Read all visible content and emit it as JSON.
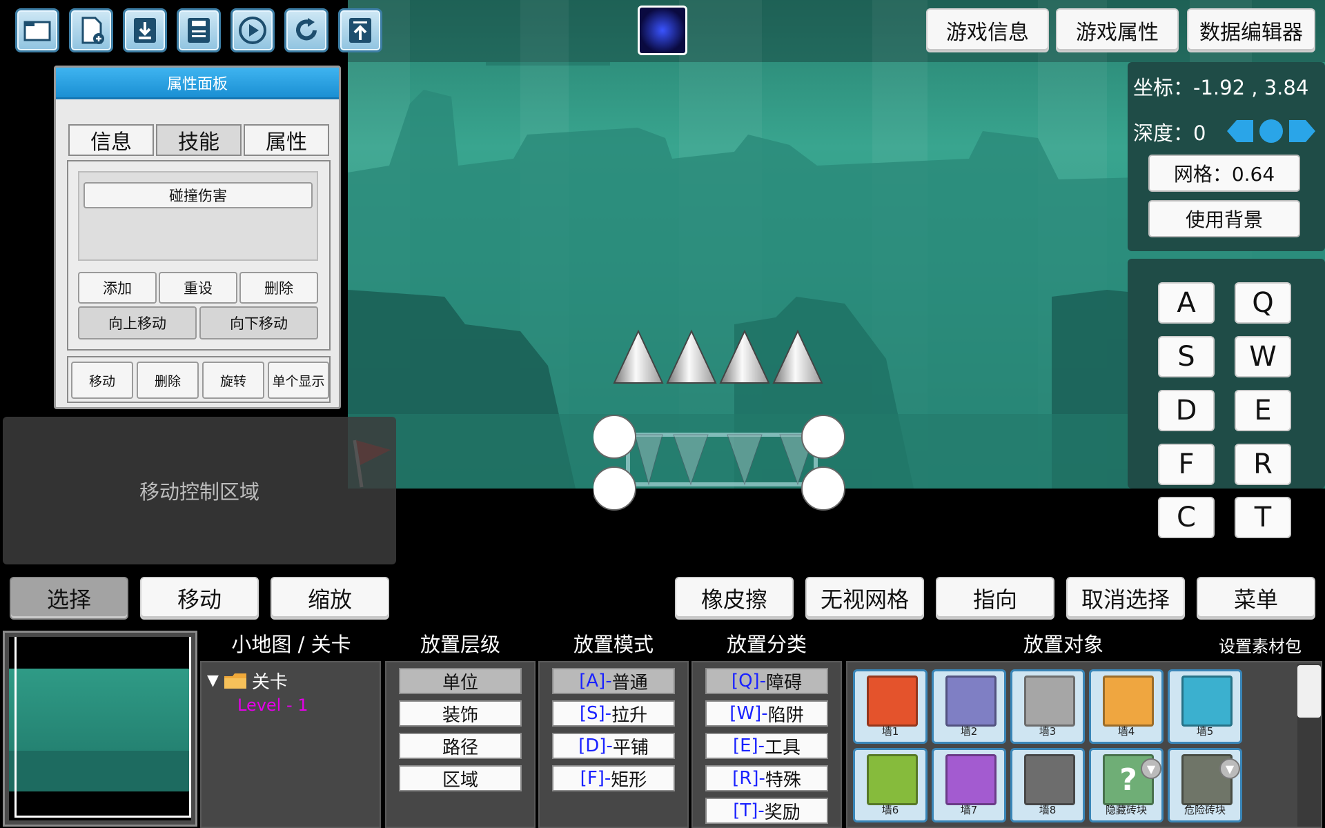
{
  "toolbar": {
    "icons": [
      "open-folder-icon",
      "new-file-icon",
      "download-icon",
      "save-icon",
      "play-icon",
      "refresh-icon",
      "upload-icon"
    ],
    "buttons": {
      "game_info": "游戏信息",
      "game_props": "游戏属性",
      "data_editor": "数据编辑器"
    }
  },
  "property_panel": {
    "title": "属性面板",
    "tabs": [
      "信息",
      "技能",
      "属性"
    ],
    "active_tab": "属性",
    "list_items": [
      "碰撞伤害"
    ],
    "actions": {
      "add": "添加",
      "reset": "重设",
      "delete": "删除",
      "move_up": "向上移动",
      "move_down": "向下移动"
    },
    "bottom": {
      "move": "移动",
      "delete": "删除",
      "rotate": "旋转",
      "single_show": "单个显示"
    }
  },
  "move_control": {
    "label": "移动控制区域"
  },
  "info": {
    "coord_label": "坐标：",
    "coord_value": "-1.92 , 3.84",
    "depth_label": "深度：",
    "depth_value": "0",
    "grid_btn": "网格：0.64",
    "use_bg_btn": "使用背景"
  },
  "keypad": {
    "keys": [
      "A",
      "Q",
      "S",
      "W",
      "D",
      "E",
      "F",
      "R",
      "C",
      "T"
    ]
  },
  "modes": {
    "select": "选择",
    "move": "移动",
    "scale": "缩放",
    "eraser": "橡皮擦",
    "ignore_grid": "无视网格",
    "direction": "指向",
    "deselect": "取消选择",
    "menu": "菜单"
  },
  "bottom": {
    "minimap_title": "小地图 / 关卡",
    "tree_root": "关卡",
    "level_name": "Level - 1",
    "layer_title": "放置层级",
    "layers": [
      "单位",
      "装饰",
      "路径",
      "区域"
    ],
    "layer_selected": "单位",
    "mode_title": "放置模式",
    "place_modes": [
      {
        "key": "[A]-",
        "name": "普通"
      },
      {
        "key": "[S]-",
        "name": "拉升"
      },
      {
        "key": "[D]-",
        "name": "平铺"
      },
      {
        "key": "[F]-",
        "name": "矩形"
      }
    ],
    "category_title": "放置分类",
    "categories": [
      {
        "key": "[Q]-",
        "name": "障碍"
      },
      {
        "key": "[W]-",
        "name": "陷阱"
      },
      {
        "key": "[E]-",
        "name": "工具"
      },
      {
        "key": "[R]-",
        "name": "特殊"
      },
      {
        "key": "[T]-",
        "name": "奖励"
      }
    ],
    "objects_title": "放置对象",
    "asset_pack": "设置素材包",
    "objects": [
      {
        "label": "墙1",
        "color": "#e4532c"
      },
      {
        "label": "墙2",
        "color": "#7f7fc4"
      },
      {
        "label": "墙3",
        "color": "#a6a6a6"
      },
      {
        "label": "墙4",
        "color": "#efa640"
      },
      {
        "label": "墙5",
        "color": "#3bb0cf"
      },
      {
        "label": "墙6",
        "color": "#86bb3c"
      },
      {
        "label": "墙7",
        "color": "#a35bd0"
      },
      {
        "label": "墙8",
        "color": "#6d6d6d"
      },
      {
        "label": "隐藏砖块",
        "color": "#6fae76"
      },
      {
        "label": "危险砖块",
        "color": "#6f7568"
      }
    ]
  }
}
